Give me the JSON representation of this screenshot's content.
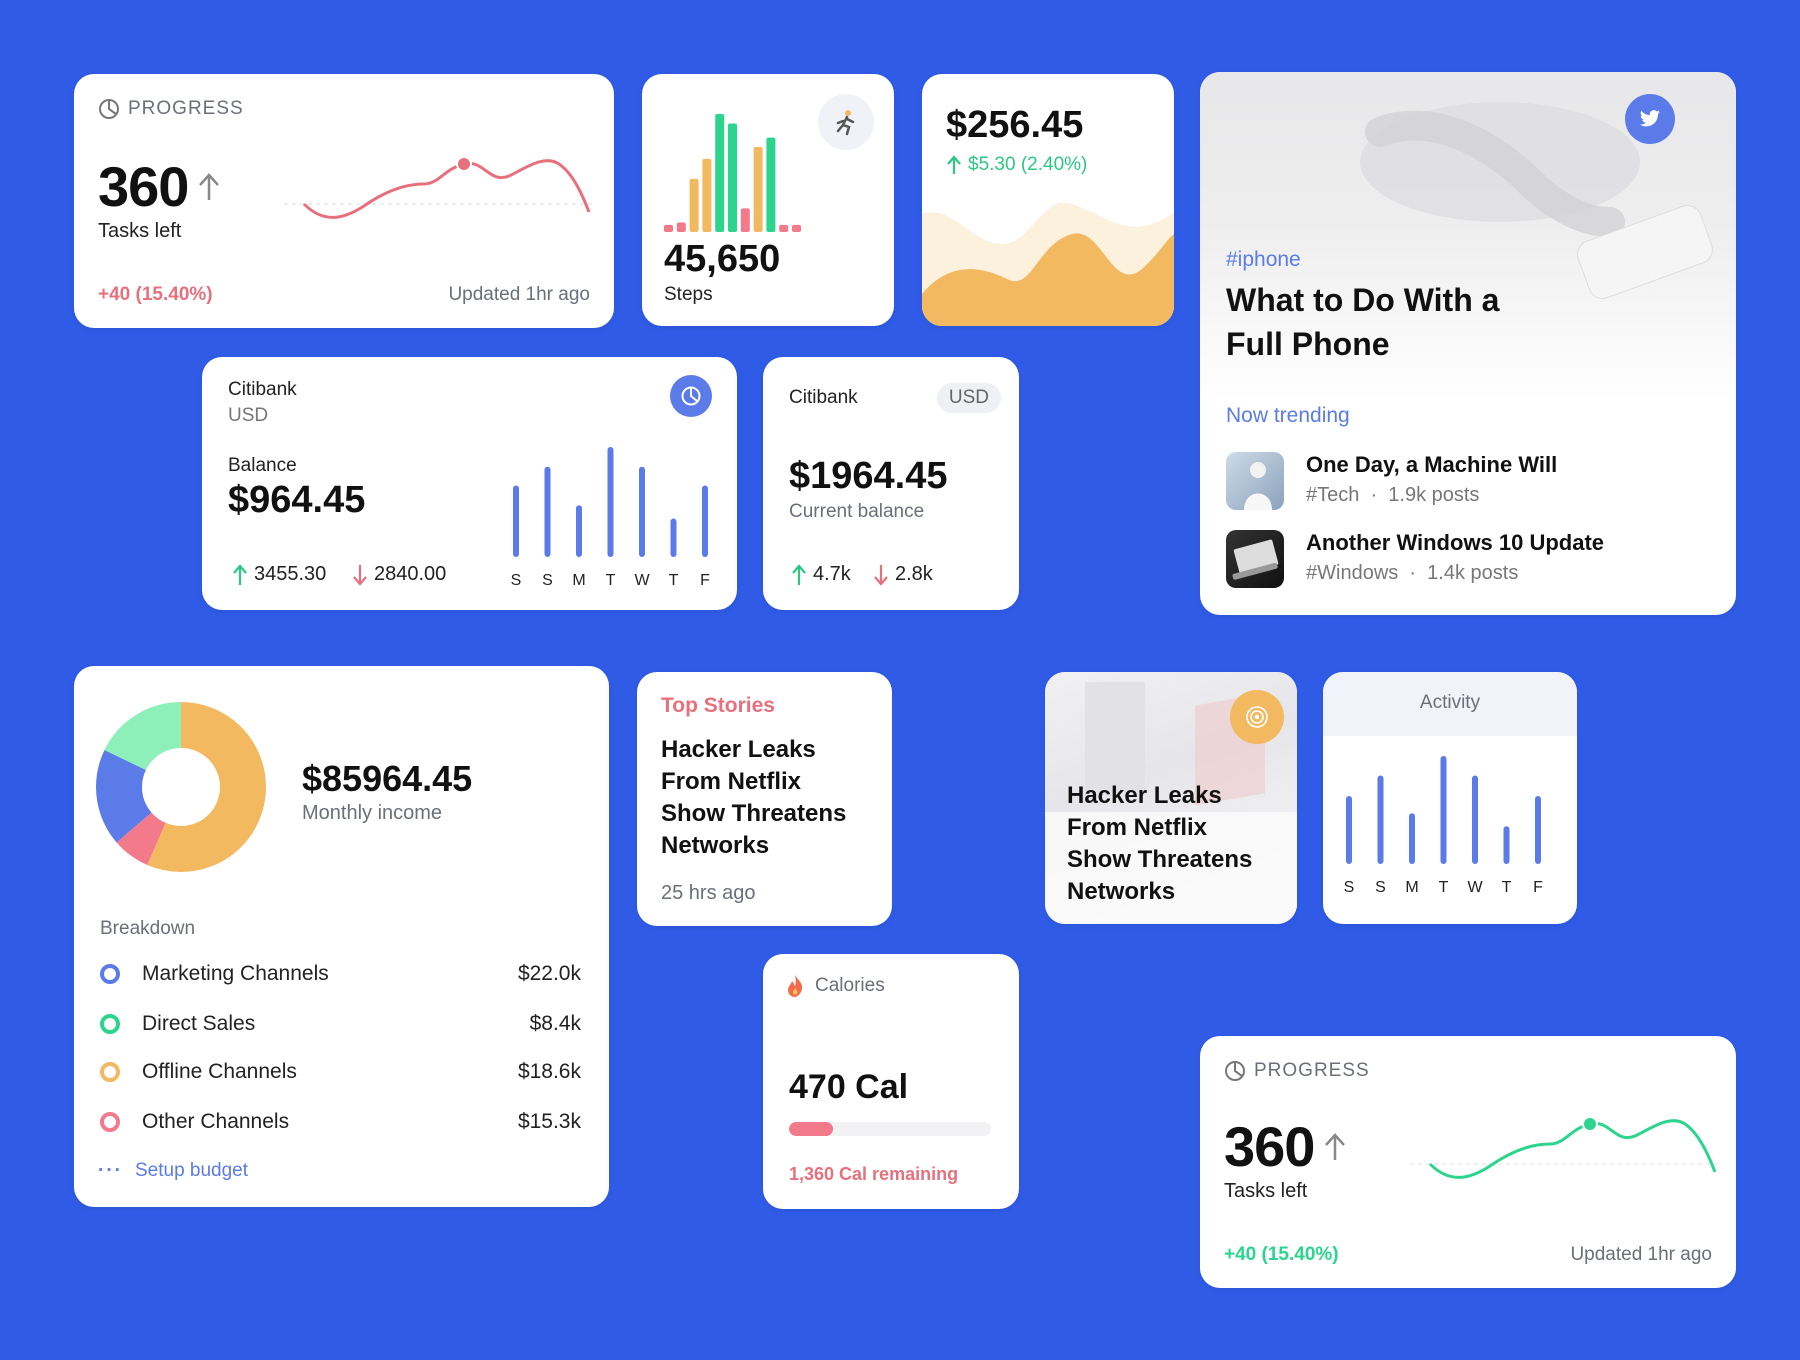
{
  "progress_card_1": {
    "title": "PROGRESS",
    "value": "360",
    "subtitle": "Tasks left",
    "delta": "+40 (15.40%)",
    "updated": "Updated 1hr ago",
    "color": "#E8707D"
  },
  "steps_card": {
    "value": "45,650",
    "label": "Steps",
    "icon": "runner-icon",
    "bar_heights": [
      0.06,
      0.08,
      0.45,
      0.62,
      1.0,
      0.92,
      0.2,
      0.72,
      0.8,
      0.06,
      0.06
    ],
    "bar_colors": [
      "#F27A8A",
      "#F27A8A",
      "#F2B960",
      "#F2B960",
      "#2CD58E",
      "#2CD58E",
      "#F27A8A",
      "#F2B960",
      "#2CD58E",
      "#F27A8A",
      "#F27A8A"
    ]
  },
  "price_card": {
    "value": "$256.45",
    "change": "$5.30 (2.40%)",
    "color": "#2CC784"
  },
  "article_card": {
    "tag": "#iphone",
    "title_line1": "What to Do With a",
    "title_line2": "Full Phone",
    "section": "Now trending",
    "icon": "twitter-icon",
    "items": [
      {
        "title": "One Day, a Machine Will",
        "tag": "#Tech",
        "posts": "1.9k posts"
      },
      {
        "title": "Another Windows 10 Update",
        "tag": "#Windows",
        "posts": "1.4k posts"
      }
    ]
  },
  "balance_card": {
    "bank": "Citibank",
    "currency": "USD",
    "balance_label": "Balance",
    "balance": "$964.45",
    "income": "3455.30",
    "expense": "2840.00",
    "icon": "pie-chart-icon",
    "days": [
      "S",
      "S",
      "M",
      "T",
      "W",
      "T",
      "F"
    ],
    "bar_levels": [
      0.65,
      0.82,
      0.47,
      1.0,
      0.82,
      0.35,
      0.65
    ]
  },
  "current_balance_card": {
    "bank": "Citibank",
    "currency": "USD",
    "amount": "$1964.45",
    "label": "Current balance",
    "up": "4.7k",
    "down": "2.8k"
  },
  "income_card": {
    "amount": "$85964.45",
    "label": "Monthly income",
    "breakdown_label": "Breakdown",
    "items": [
      {
        "name": "Marketing Channels",
        "value": "$22.0k",
        "color": "#5B7BE9"
      },
      {
        "name": "Direct Sales",
        "value": "$8.4k",
        "color": "#2CD58E"
      },
      {
        "name": "Offline Channels",
        "value": "$18.6k",
        "color": "#F2B960"
      },
      {
        "name": "Other Channels",
        "value": "$15.3k",
        "color": "#F27A8A"
      }
    ],
    "link": "Setup budget"
  },
  "top_stories_card": {
    "title": "Top Stories",
    "headline_lines": [
      "Hacker Leaks",
      "From Netflix",
      "Show Threatens",
      "Networks"
    ],
    "time": "25 hrs ago"
  },
  "image_story_card": {
    "headline_lines": [
      "Hacker Leaks",
      "From Netflix",
      "Show Threatens",
      "Networks"
    ],
    "icon": "target-icon"
  },
  "activity_card": {
    "title": "Activity",
    "days": [
      "S",
      "S",
      "M",
      "T",
      "W",
      "T",
      "F"
    ],
    "bar_levels": [
      0.63,
      0.82,
      0.47,
      1.0,
      0.82,
      0.35,
      0.63
    ]
  },
  "calories_card": {
    "title": "Calories",
    "value": "470 Cal",
    "remaining": "1,360 Cal remaining",
    "progress": 0.22,
    "icon": "fire-icon"
  },
  "progress_card_2": {
    "title": "PROGRESS",
    "value": "360",
    "subtitle": "Tasks left",
    "delta": "+40 (15.40%)",
    "updated": "Updated 1hr ago",
    "color": "#2CD58E"
  }
}
